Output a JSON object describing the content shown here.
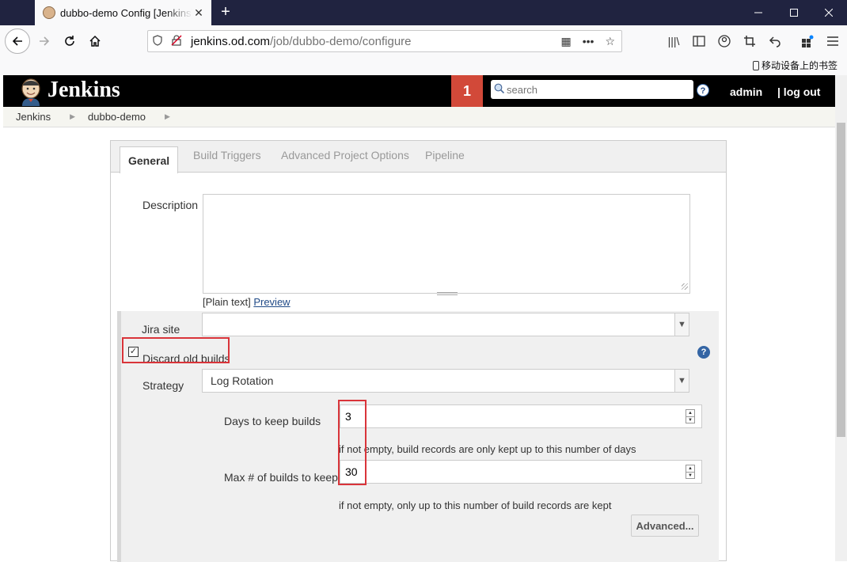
{
  "browser": {
    "tab_title": "dubbo-demo Config [Jenkins]",
    "new_tab": "+",
    "url_host": "jenkins.od.com",
    "url_path": "/job/dubbo-demo/configure",
    "bookmark_label": "移动设备上的书签"
  },
  "jenkins": {
    "title": "Jenkins",
    "notification_count": "1",
    "search_placeholder": "search",
    "user": "admin",
    "logout": "| log out",
    "breadcrumbs": [
      "Jenkins",
      "dubbo-demo"
    ]
  },
  "config": {
    "tabs": [
      "General",
      "Build Triggers",
      "Advanced Project Options",
      "Pipeline"
    ],
    "description_label": "Description",
    "description_value": "",
    "plain_text": "[Plain text]",
    "preview": "Preview",
    "jira_label": "Jira site",
    "jira_value": "",
    "discard_label": "Discard old builds",
    "discard_checked": true,
    "strategy_label": "Strategy",
    "strategy_value": "Log Rotation",
    "days_label": "Days to keep builds",
    "days_value": "3",
    "days_hint": "if not empty, build records are only kept up to this number of days",
    "max_label": "Max # of builds to keep",
    "max_value": "30",
    "max_hint": "if not empty, only up to this number of build records are kept",
    "advanced_button": "Advanced..."
  },
  "colors": {
    "jenkins_header": "#000000",
    "badge": "#d24939",
    "highlight": "#d9343a",
    "link": "#204a87"
  }
}
